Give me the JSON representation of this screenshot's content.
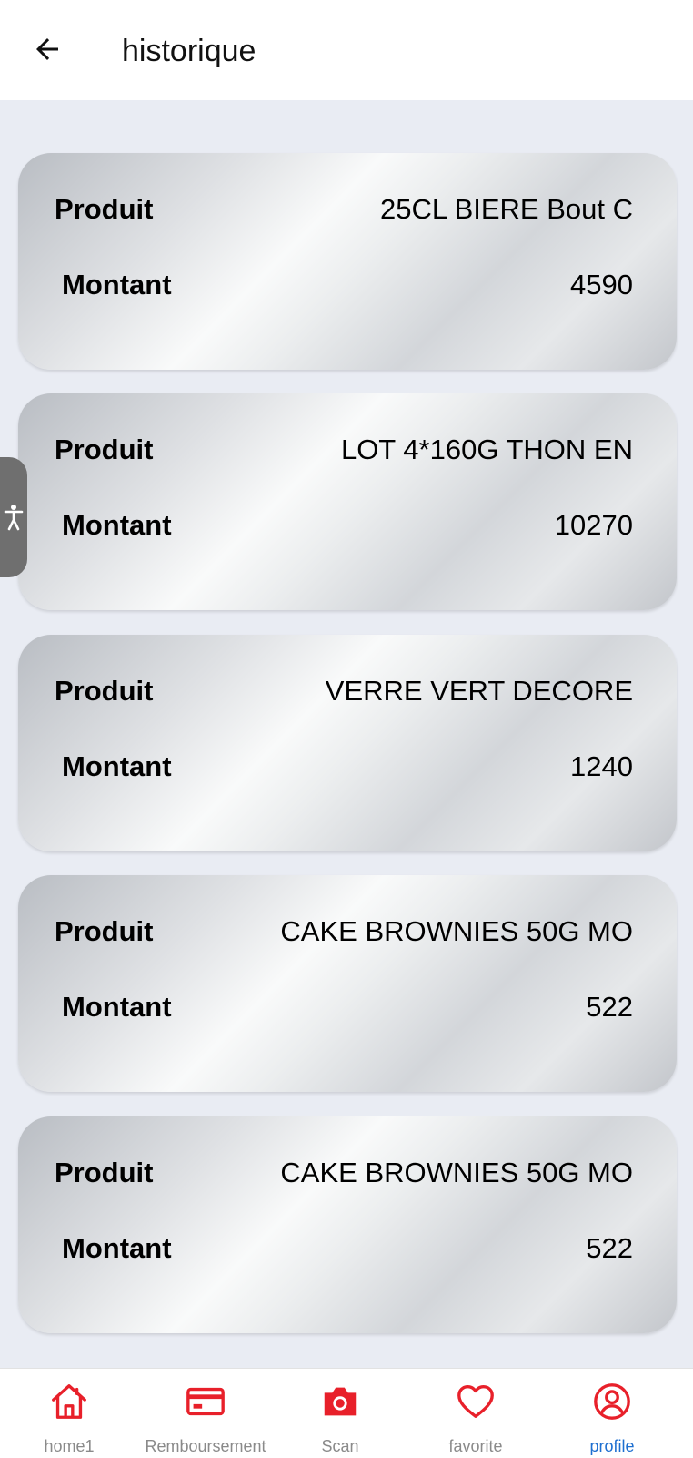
{
  "header": {
    "title": "historique"
  },
  "colors": {
    "accent": "#e8202a",
    "active_label": "#1e6fd0",
    "background": "#e9ecf3"
  },
  "items": [
    {
      "label_product": "Produit",
      "product": "25CL BIERE Bout C",
      "label_amount": "Montant",
      "amount": "4590"
    },
    {
      "label_product": "Produit",
      "product": "LOT 4*160G THON EN",
      "label_amount": "Montant",
      "amount": "10270"
    },
    {
      "label_product": "Produit",
      "product": "VERRE VERT DECORE",
      "label_amount": "Montant",
      "amount": "1240"
    },
    {
      "label_product": "Produit",
      "product": "CAKE BROWNIES 50G MO",
      "label_amount": "Montant",
      "amount": "522"
    },
    {
      "label_product": "Produit",
      "product": "CAKE BROWNIES 50G MO",
      "label_amount": "Montant",
      "amount": "522"
    }
  ],
  "nav": [
    {
      "label": "home1",
      "icon": "home-icon"
    },
    {
      "label": "Remboursement",
      "icon": "card-icon"
    },
    {
      "label": "Scan",
      "icon": "camera-icon"
    },
    {
      "label": "favorite",
      "icon": "heart-icon"
    },
    {
      "label": "profile",
      "icon": "profile-icon",
      "active": true
    }
  ]
}
